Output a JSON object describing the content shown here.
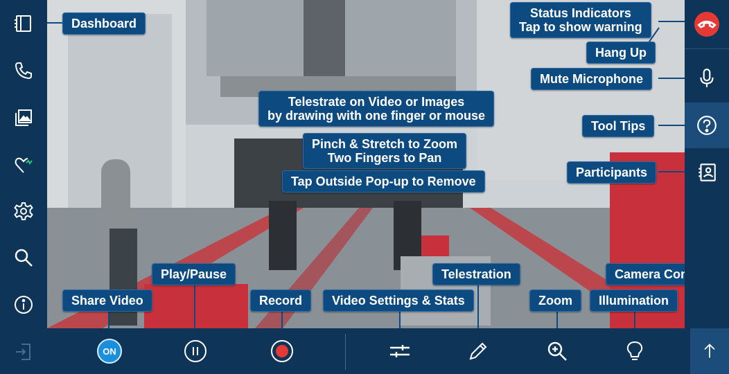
{
  "tooltips": {
    "dashboard": "Dashboard",
    "status_line1": "Status Indicators",
    "status_line2": "Tap to show warning",
    "hang_up": "Hang Up",
    "mute": "Mute Microphone",
    "tool_tips": "Tool Tips",
    "participants": "Participants",
    "telestrate_line1": "Telestrate on Video or Images",
    "telestrate_line2": "by drawing with one finger or mouse",
    "zoom_line1": "Pinch & Stretch to Zoom",
    "zoom_line2": "Two Fingers to Pan",
    "tap_outside": "Tap Outside Pop-up to Remove",
    "play_pause": "Play/Pause",
    "share_video": "Share Video",
    "record": "Record",
    "video_settings": "Video Settings & Stats",
    "telestration": "Telestration",
    "zoom": "Zoom",
    "illumination": "Illumination",
    "camera_controls": "Camera Controls"
  },
  "bottom": {
    "share_state": "ON"
  },
  "colors": {
    "accent": "#0d4a80",
    "hangup": "#e53935",
    "record": "#e53935",
    "on_badge": "#1a8fe0"
  }
}
